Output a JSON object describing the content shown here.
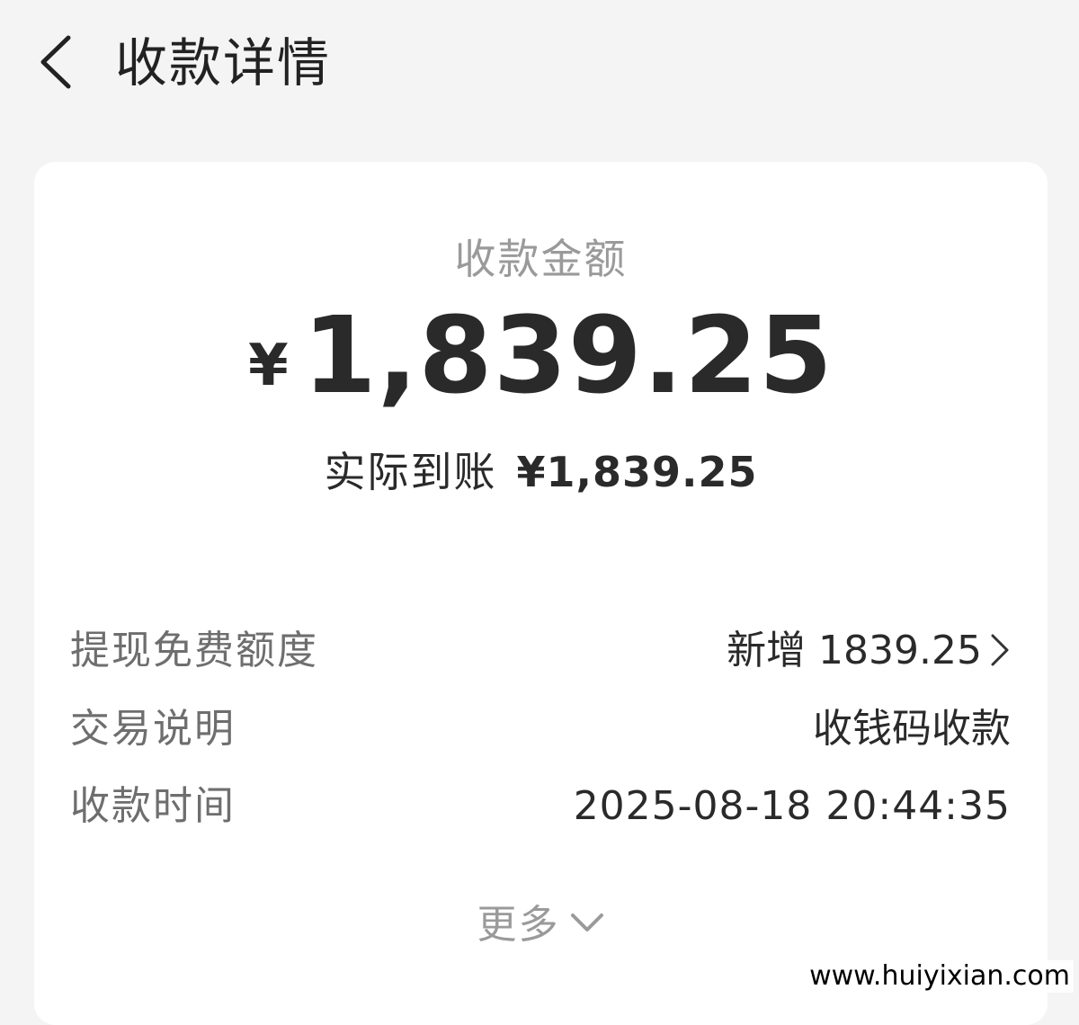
{
  "header": {
    "title": "收款详情"
  },
  "summary": {
    "amount_label": "收款金额",
    "currency_symbol": "¥",
    "amount": "1,839.25",
    "actual_label": "实际到账",
    "actual_amount": "¥1,839.25"
  },
  "details": [
    {
      "label": "提现免费额度",
      "value": "新增 1839.25"
    },
    {
      "label": "交易说明",
      "value": "收钱码收款"
    },
    {
      "label": "收款时间",
      "value": "2025-08-18 20:44:35"
    }
  ],
  "more_label": "更多",
  "watermark": "www.huiyixian.com",
  "colors": {
    "background": "#f4f4f4",
    "card": "#ffffff",
    "primary_text": "#222222",
    "muted_text": "#9a9a9a",
    "label_text": "#6e6e6e"
  },
  "icons": {
    "back": "chevron-left-icon",
    "quota_arrow": "chevron-right-icon",
    "more_arrow": "chevron-down-icon"
  }
}
